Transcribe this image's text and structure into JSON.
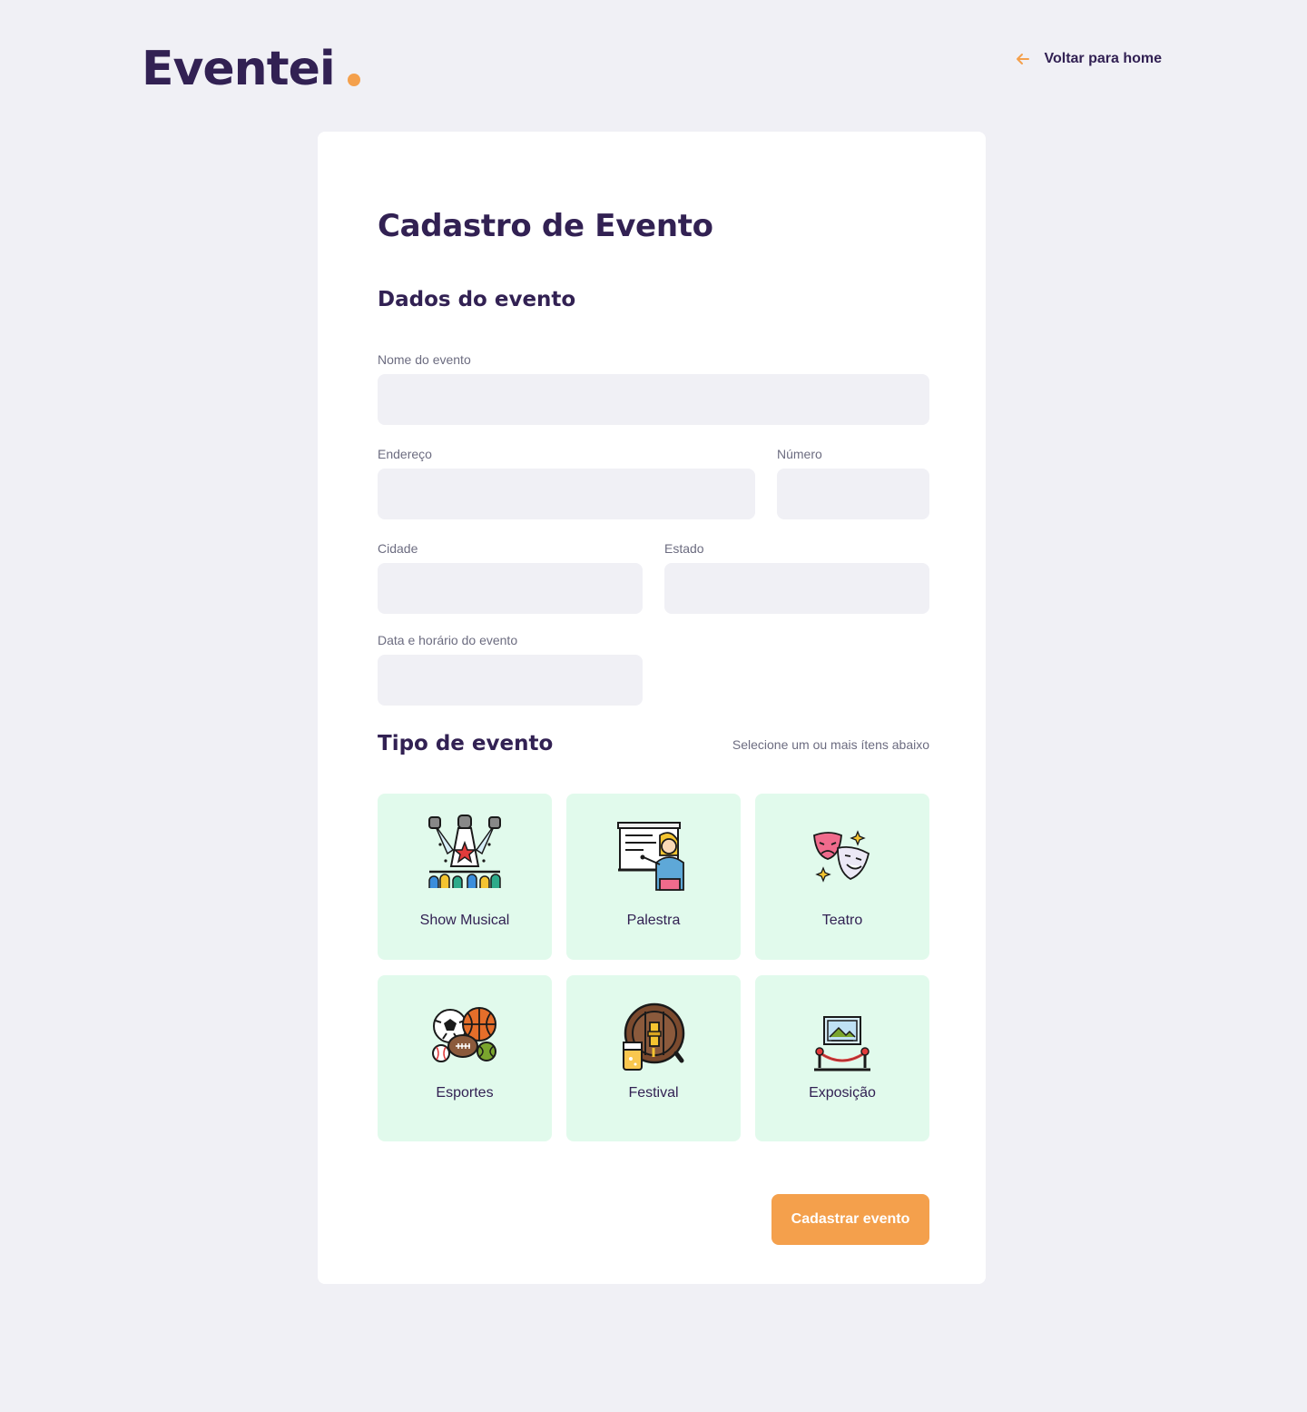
{
  "brand": {
    "name": "Eventei",
    "accent": "#F4A04C",
    "primary": "#322153"
  },
  "nav": {
    "back_label": "Voltar para home",
    "back_icon": "arrow-left-icon"
  },
  "page": {
    "title": "Cadastro de Evento"
  },
  "event_data": {
    "section_title": "Dados do evento",
    "fields": {
      "name": {
        "label": "Nome do evento",
        "value": ""
      },
      "address": {
        "label": "Endereço",
        "value": ""
      },
      "number": {
        "label": "Número",
        "value": ""
      },
      "city": {
        "label": "Cidade",
        "value": ""
      },
      "state": {
        "label": "Estado",
        "value": ""
      },
      "datetime": {
        "label": "Data e horário do evento",
        "value": ""
      }
    }
  },
  "event_type": {
    "section_title": "Tipo de evento",
    "hint": "Selecione um ou mais ítens abaixo",
    "items": [
      {
        "label": "Show Musical",
        "icon": "concert-stage-icon"
      },
      {
        "label": "Palestra",
        "icon": "lecture-presenter-icon"
      },
      {
        "label": "Teatro",
        "icon": "theater-masks-icon"
      },
      {
        "label": "Esportes",
        "icon": "sports-balls-icon"
      },
      {
        "label": "Festival",
        "icon": "beer-barrel-icon"
      },
      {
        "label": "Exposição",
        "icon": "exhibition-painting-icon"
      }
    ],
    "tile_color": "#E1FAEC"
  },
  "actions": {
    "submit_label": "Cadastrar evento"
  }
}
